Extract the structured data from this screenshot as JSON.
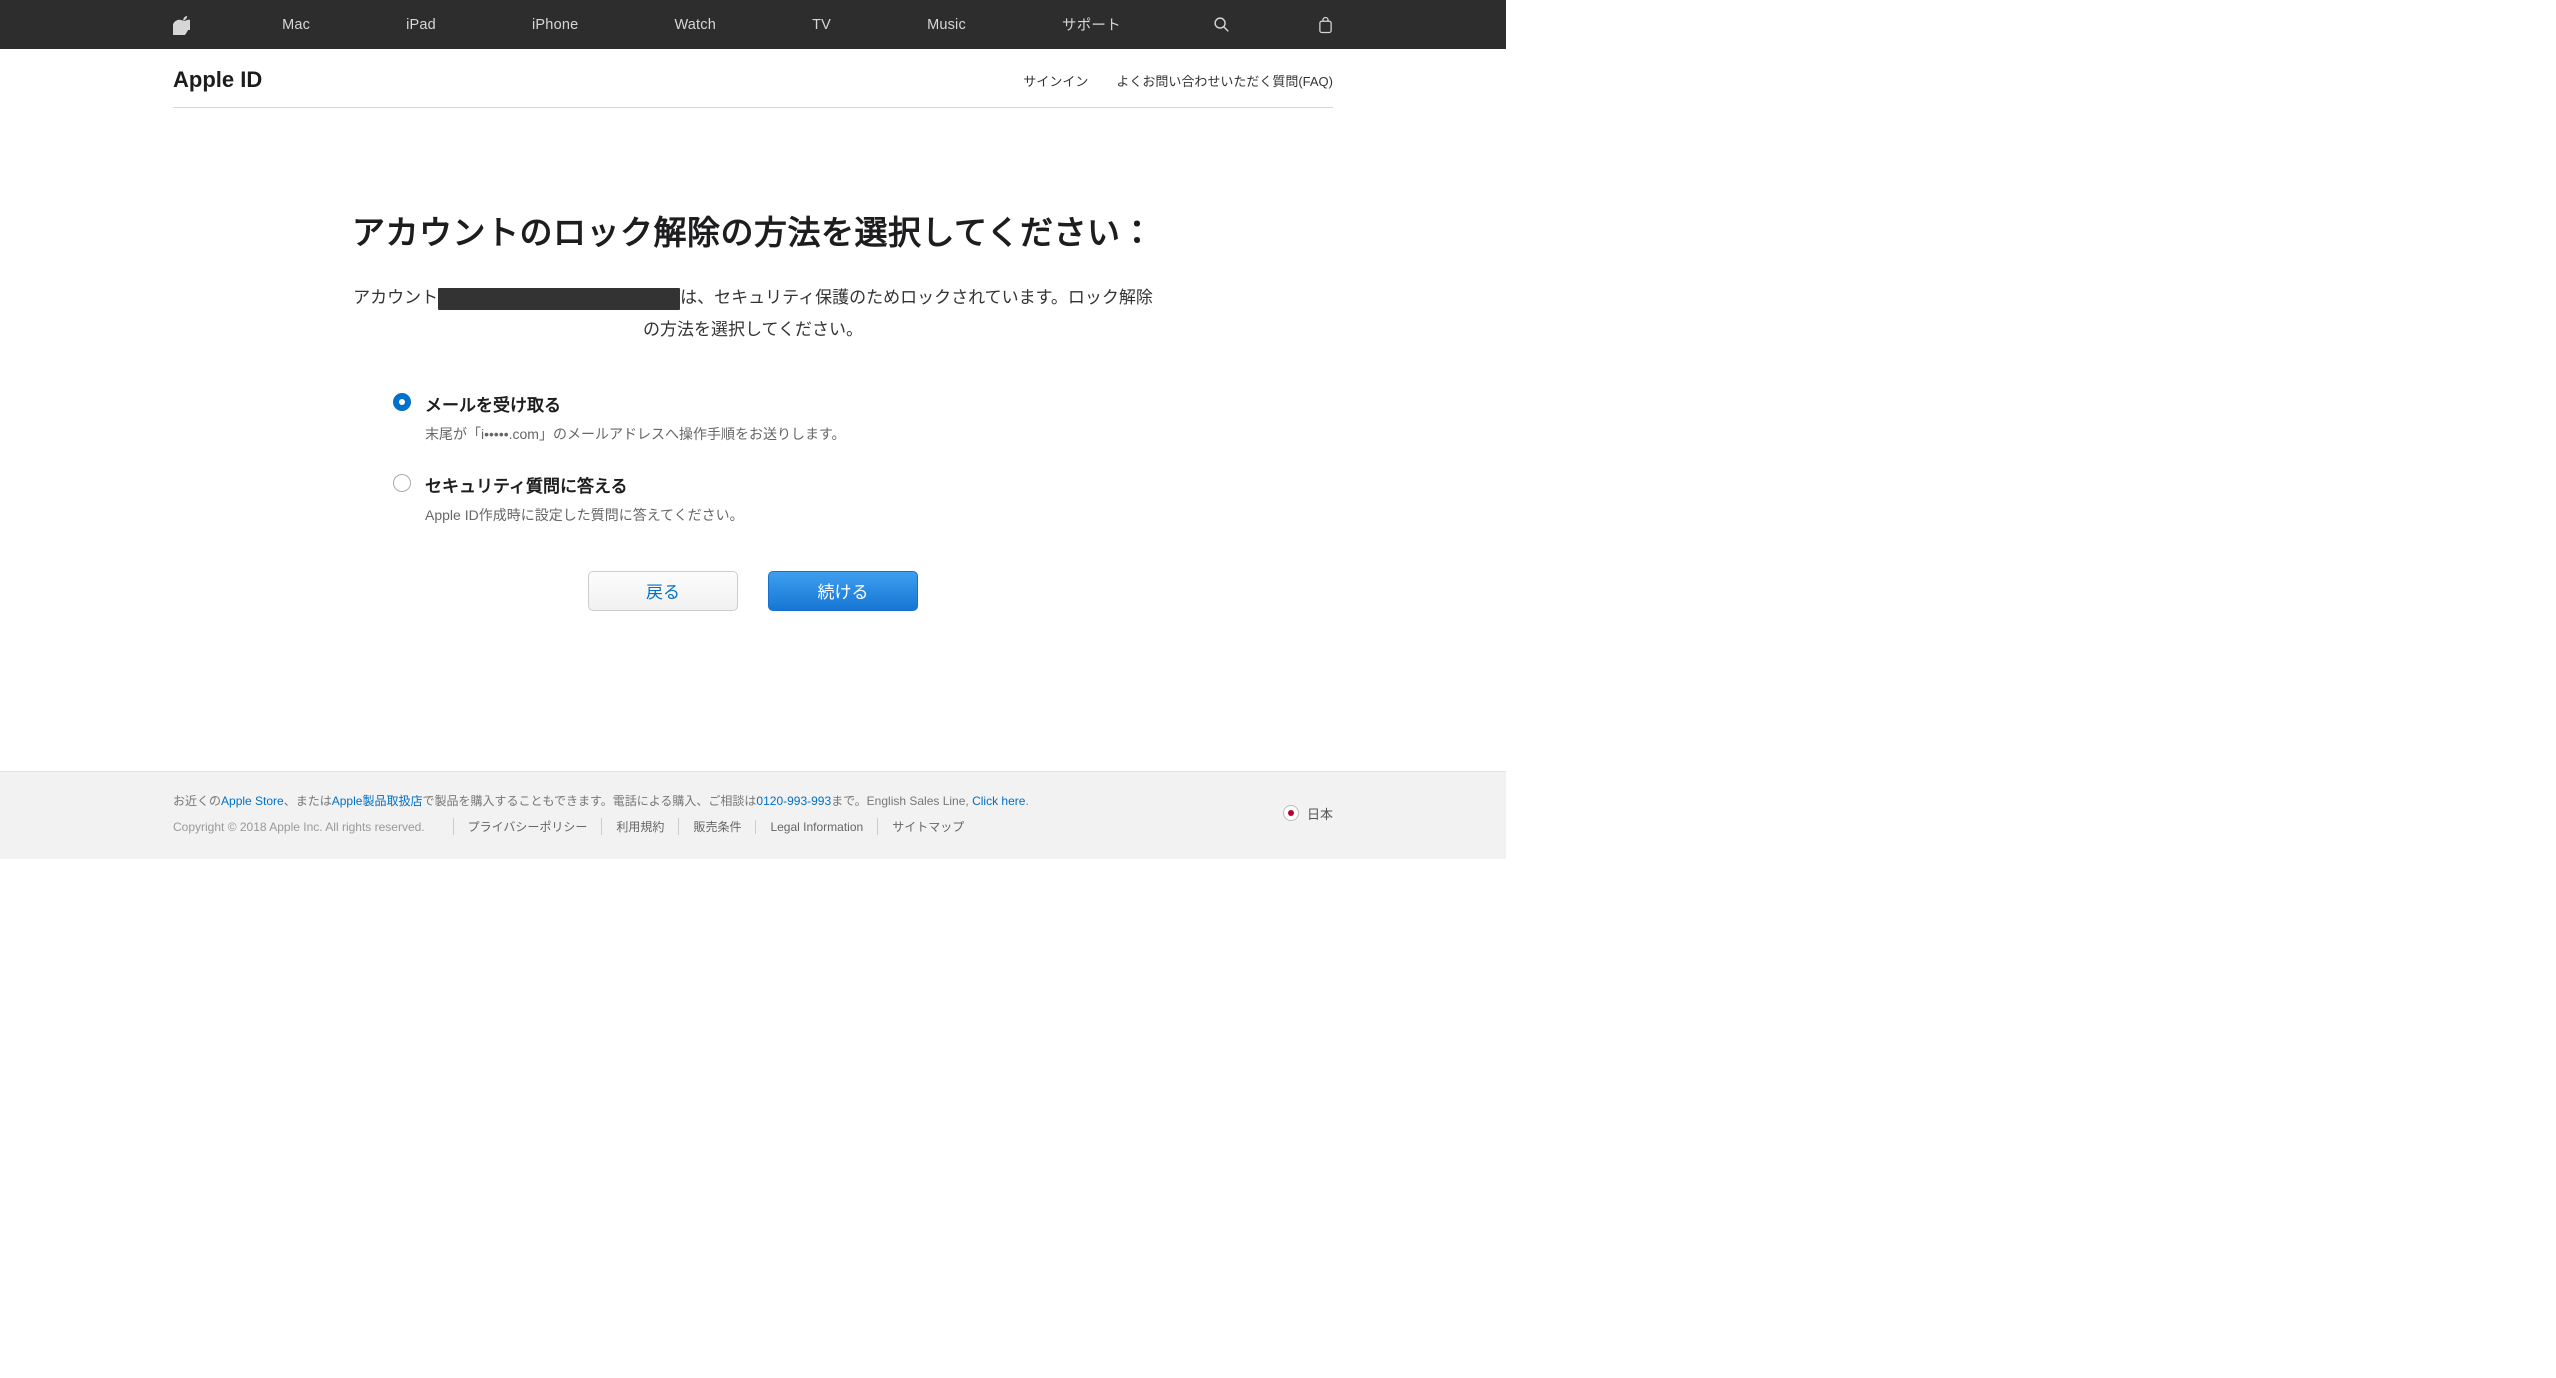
{
  "globalNav": {
    "items": [
      "Mac",
      "iPad",
      "iPhone",
      "Watch",
      "TV",
      "Music",
      "サポート"
    ]
  },
  "subHeader": {
    "title": "Apple ID",
    "links": {
      "signin": "サインイン",
      "faq": "よくお問い合わせいただく質問(FAQ)"
    }
  },
  "main": {
    "heading": "アカウントのロック解除の方法を選択してください：",
    "desc_pre": "アカウント",
    "desc_mid": "は、セキュリティ保護のためロックされています。ロック解除",
    "desc_post": "の方法を選択してください。"
  },
  "options": {
    "email": {
      "title": "メールを受け取る",
      "desc": "末尾が「i•••••.com」のメールアドレスへ操作手順をお送りします。",
      "selected": true
    },
    "security": {
      "title": "セキュリティ質問に答える",
      "desc": "Apple ID作成時に設定した質問に答えてください。",
      "selected": false
    }
  },
  "buttons": {
    "back": "戻る",
    "continue": "続ける"
  },
  "footer": {
    "row1_pre": "お近くの",
    "row1_link1": "Apple Store",
    "row1_mid1": "、または",
    "row1_link2": "Apple製品取扱店",
    "row1_mid2": "で製品を購入することもできます。電話による購入、ご相談は",
    "row1_phone": "0120-993-993",
    "row1_mid3": "まで。English Sales Line, ",
    "row1_link3": "Click here",
    "row1_end": ".",
    "copyright": "Copyright © 2018 Apple Inc. All rights reserved.",
    "links": [
      "プライバシーポリシー",
      "利用規約",
      "販売条件",
      "Legal Information",
      "サイトマップ"
    ],
    "locale": "日本"
  }
}
